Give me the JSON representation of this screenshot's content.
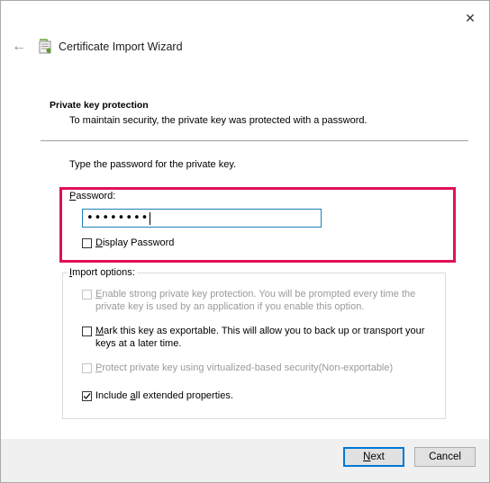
{
  "window": {
    "title": "Certificate Import Wizard",
    "close_glyph": "✕",
    "back_glyph": "←"
  },
  "page": {
    "heading": "Private key protection",
    "subheading": "To maintain security, the private key was protected with a password.",
    "instruction": "Type the password for the private key."
  },
  "password": {
    "label_prefix": "P",
    "label_rest": "assword:",
    "value": "••••••••",
    "display_checkbox": {
      "checked": false,
      "label_prefix": "D",
      "label_rest": "isplay Password"
    }
  },
  "import_options": {
    "legend_prefix": "I",
    "legend_rest": "mport options:",
    "options": [
      {
        "checked": false,
        "enabled": false,
        "prefix": "E",
        "text": "nable strong private key protection. You will be prompted every time the private key is used by an application if you enable this option."
      },
      {
        "checked": false,
        "enabled": true,
        "prefix": "M",
        "text": "ark this key as exportable. This will allow you to back up or transport your keys at a later time."
      },
      {
        "checked": false,
        "enabled": false,
        "prefix": "P",
        "text": "rotect private key using virtualized-based security(Non-exportable)"
      },
      {
        "checked": true,
        "enabled": true,
        "prefix": "Include ",
        "underline": "a",
        "text": "ll extended properties."
      }
    ]
  },
  "footer": {
    "next_prefix": "N",
    "next_rest": "ext",
    "cancel_label": "Cancel"
  },
  "colors": {
    "highlight": "#e0105a",
    "focus_border": "#1e7fb8",
    "default_button_border": "#0078d7"
  }
}
